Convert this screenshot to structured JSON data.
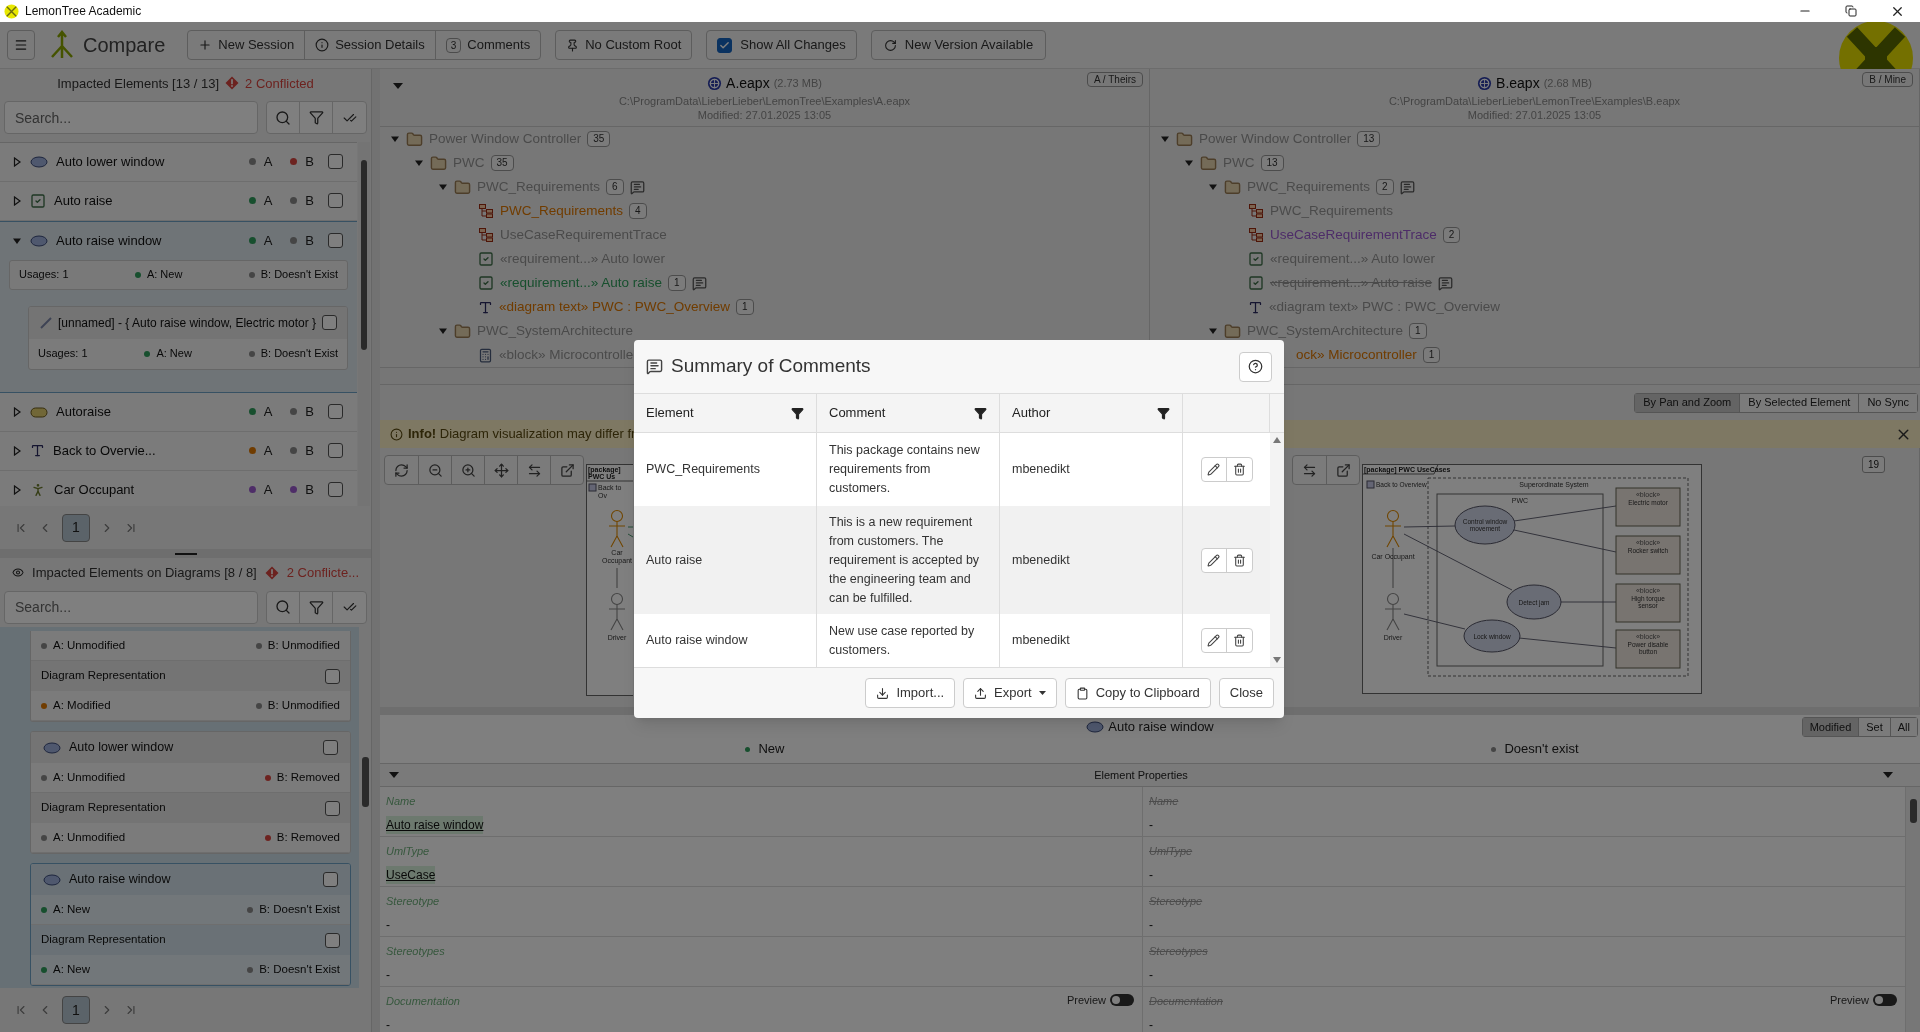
{
  "window": {
    "title": "LemonTree Academic"
  },
  "toolbar": {
    "title": "Compare",
    "group": [
      {
        "kind": "plus",
        "label": "New Session"
      },
      {
        "kind": "info",
        "label": "Session Details"
      },
      {
        "kind": "count",
        "count": "3",
        "label": "Comments"
      }
    ],
    "custom_root": "No Custom Root",
    "show_all": {
      "label": "Show All Changes",
      "checked": true
    },
    "new_version": "New Version Available"
  },
  "impacted": {
    "title": "Impacted Elements [13 / 13]",
    "conflicts": "2 Conflicted",
    "placeholder": "Search...",
    "page": "1",
    "items": [
      {
        "name": "Auto lower window",
        "kind": "usecase",
        "expanded": false,
        "selected": false,
        "checked": false,
        "a": {
          "label": "A",
          "color": "#454545"
        },
        "b": {
          "label": "B",
          "color": "#6d2320"
        }
      },
      {
        "name": "Auto raise",
        "kind": "requirement",
        "expanded": false,
        "selected": false,
        "checked": false,
        "a": {
          "label": "A",
          "color": "#174f2e"
        },
        "b": {
          "label": "B",
          "color": "#454545"
        }
      },
      {
        "name": "Auto raise window",
        "kind": "usecase",
        "expanded": true,
        "selected": true,
        "checked": false,
        "a": {
          "label": "A",
          "color": "#174f2e"
        },
        "b": {
          "label": "B",
          "color": "#454545"
        },
        "usage": {
          "text": "Usages: 1",
          "a": {
            "label": "A: New",
            "color": "#174f2e"
          },
          "b": {
            "label": "B: Doesn't Exist",
            "color": "#454545"
          }
        },
        "children": [
          {
            "name": "[unnamed] - { Auto raise window, Electric motor }",
            "kind": "connector",
            "checked": false,
            "usage": {
              "text": "Usages: 1",
              "a": {
                "label": "A: New",
                "color": "#174f2e"
              },
              "b": {
                "label": "B: Doesn't Exist",
                "color": "#454545"
              }
            }
          }
        ]
      },
      {
        "name": "Autoraise",
        "kind": "state",
        "expanded": false,
        "selected": false,
        "checked": false,
        "a": {
          "label": "A",
          "color": "#174f2e"
        },
        "b": {
          "label": "B",
          "color": "#454545"
        }
      },
      {
        "name": "Back to Overvie...",
        "kind": "text",
        "expanded": false,
        "selected": false,
        "checked": false,
        "a": {
          "label": "A",
          "color": "#703c00"
        },
        "b": {
          "label": "B",
          "color": "#454545"
        }
      },
      {
        "name": "Car Occupant",
        "kind": "actor",
        "expanded": false,
        "selected": false,
        "checked": false,
        "a": {
          "label": "A",
          "color": "#4e2d68"
        },
        "b": {
          "label": "B",
          "color": "#4e2d68"
        }
      }
    ]
  },
  "diagram_impacts": {
    "title": "Impacted Elements on Diagrams [8 / 8]",
    "conflicts": "2 Conflicte...",
    "placeholder": "Search...",
    "page": "1",
    "cards": [
      {
        "selected": false,
        "rows": [
          {
            "kind": "status",
            "a": {
              "label": "A: Unmodified",
              "color": "#454545"
            },
            "b": {
              "label": "B: Unmodified",
              "color": "#454545"
            }
          },
          {
            "kind": "representation",
            "label": "Diagram Representation",
            "checked": false
          },
          {
            "kind": "status",
            "a": {
              "label": "A: Modified",
              "color": "#703c00"
            },
            "b": {
              "label": "B: Unmodified",
              "color": "#454545"
            }
          }
        ]
      },
      {
        "title": "Auto lower window",
        "kind": "usecase",
        "checked": false,
        "selected": false,
        "rows": [
          {
            "kind": "status",
            "a": {
              "label": "A: Unmodified",
              "color": "#454545"
            },
            "b": {
              "label": "B: Removed",
              "color": "#6d2320"
            }
          },
          {
            "kind": "representation",
            "label": "Diagram Representation",
            "checked": false
          },
          {
            "kind": "status",
            "a": {
              "label": "A: Unmodified",
              "color": "#454545"
            },
            "b": {
              "label": "B: Removed",
              "color": "#6d2320"
            }
          }
        ]
      },
      {
        "title": "Auto raise window",
        "kind": "usecase",
        "checked": false,
        "selected": true,
        "rows": [
          {
            "kind": "status",
            "a": {
              "label": "A: New",
              "color": "#174f2e"
            },
            "b": {
              "label": "B: Doesn't Exist",
              "color": "#454545"
            }
          },
          {
            "kind": "representation",
            "label": "Diagram Representation",
            "checked": false
          },
          {
            "kind": "status",
            "a": {
              "label": "A: New",
              "color": "#174f2e"
            },
            "b": {
              "label": "B: Doesn't Exist",
              "color": "#454545"
            }
          }
        ]
      }
    ]
  },
  "sides": [
    {
      "file": "A.eapx",
      "size": "(2.73 MB)",
      "path": "C:\\ProgramData\\LieberLieber\\LemonTree\\Examples\\A.eapx",
      "modified": "Modified: 27.01.2025 13:05",
      "tag": "A / Theirs",
      "tree": [
        {
          "label": "Power Window Controller",
          "kind": "folder",
          "modified": false,
          "added": false,
          "moved": false,
          "deleted": false,
          "comment": false,
          "count": "35",
          "expanded": true,
          "children": [
            {
              "label": "PWC",
              "kind": "folder",
              "modified": false,
              "added": false,
              "moved": false,
              "deleted": false,
              "comment": false,
              "count": "35",
              "expanded": true,
              "children": [
                {
                  "label": "PWC_Requirements",
                  "kind": "folder",
                  "modified": false,
                  "added": false,
                  "moved": false,
                  "deleted": false,
                  "comment": true,
                  "count": "6",
                  "expanded": true,
                  "children": [
                    {
                      "label": "PWC_Requirements",
                      "kind": "diagram",
                      "modified": true,
                      "added": false,
                      "moved": false,
                      "deleted": false,
                      "comment": false,
                      "count": "4"
                    },
                    {
                      "label": "UseCaseRequirementTrace",
                      "kind": "diagram",
                      "modified": false,
                      "added": false,
                      "moved": false,
                      "deleted": false,
                      "comment": false
                    },
                    {
                      "label": "«requirement...» Auto lower",
                      "kind": "requirement",
                      "modified": false,
                      "added": false,
                      "moved": false,
                      "deleted": false,
                      "comment": false
                    },
                    {
                      "label": "«requirement...» Auto raise",
                      "kind": "requirement",
                      "modified": false,
                      "added": true,
                      "moved": false,
                      "deleted": false,
                      "comment": true,
                      "count": "1"
                    },
                    {
                      "label": "«diagram text» PWC : PWC_Overview",
                      "kind": "text",
                      "modified": true,
                      "added": false,
                      "moved": false,
                      "deleted": false,
                      "comment": false,
                      "count": "1"
                    }
                  ]
                },
                {
                  "label": "PWC_SystemArchitecture",
                  "kind": "folder",
                  "modified": false,
                  "added": false,
                  "moved": false,
                  "deleted": false,
                  "comment": false,
                  "expanded": true,
                  "children": [
                    {
                      "label": "«block» Microcontrolle",
                      "kind": "block",
                      "modified": false,
                      "added": false,
                      "moved": false,
                      "deleted": false,
                      "comment": false
                    }
                  ]
                }
              ]
            }
          ]
        }
      ]
    },
    {
      "file": "B.eapx",
      "size": "(2.68 MB)",
      "path": "C:\\ProgramData\\LieberLieber\\LemonTree\\Examples\\B.eapx",
      "modified": "Modified: 27.01.2025 13:05",
      "tag": "B / Mine",
      "tree": [
        {
          "label": "Power Window Controller",
          "kind": "folder",
          "modified": false,
          "added": false,
          "moved": false,
          "deleted": false,
          "comment": false,
          "count": "13",
          "expanded": true,
          "children": [
            {
              "label": "PWC",
              "kind": "folder",
              "modified": false,
              "added": false,
              "moved": false,
              "deleted": false,
              "comment": false,
              "count": "13",
              "expanded": true,
              "children": [
                {
                  "label": "PWC_Requirements",
                  "kind": "folder",
                  "modified": false,
                  "added": false,
                  "moved": false,
                  "deleted": false,
                  "comment": true,
                  "count": "2",
                  "expanded": true,
                  "children": [
                    {
                      "label": "PWC_Requirements",
                      "kind": "diagram",
                      "modified": false,
                      "added": false,
                      "moved": false,
                      "deleted": false,
                      "comment": false
                    },
                    {
                      "label": "UseCaseRequirementTrace",
                      "kind": "diagram",
                      "modified": false,
                      "added": false,
                      "moved": true,
                      "deleted": false,
                      "comment": false,
                      "count": "2"
                    },
                    {
                      "label": "«requirement...» Auto lower",
                      "kind": "requirement",
                      "modified": false,
                      "added": false,
                      "moved": false,
                      "deleted": false,
                      "comment": false
                    },
                    {
                      "label": "«requirement...» Auto raise",
                      "kind": "requirement",
                      "modified": false,
                      "added": false,
                      "moved": false,
                      "deleted": true,
                      "comment": true
                    },
                    {
                      "label": "«diagram text» PWC : PWC_Overview",
                      "kind": "text",
                      "modified": false,
                      "added": false,
                      "moved": false,
                      "deleted": false,
                      "comment": false
                    }
                  ]
                },
                {
                  "label": "PWC_SystemArchitecture",
                  "kind": "folder",
                  "modified": false,
                  "added": false,
                  "moved": false,
                  "deleted": false,
                  "comment": false,
                  "count": "1",
                  "expanded": true,
                  "children": [
                    {
                      "label": "ock» Microcontroller",
                      "modified": true,
                      "added": false,
                      "moved": false,
                      "deleted": false,
                      "comment": false,
                      "count": "1"
                    }
                  ]
                }
              ]
            }
          ]
        }
      ]
    }
  ],
  "sync": [
    {
      "label": "By Pan and Zoom",
      "selected": true
    },
    {
      "label": "By Selected Element",
      "selected": false
    },
    {
      "label": "No Sync",
      "selected": false
    }
  ],
  "info": "**Info!** Diagram visualization may differ fr",
  "diagrams": [
    {
      "title": "[package] PWC  Us",
      "link": "Back to Ov",
      "actors": [
        "Car Occupant",
        "Driver"
      ]
    },
    {
      "title": "[package] PWC  UseCases",
      "link": "Back to Overview",
      "boundary": "Superordinate System",
      "subject": "PWC",
      "use_cases": [
        "Control window movement",
        "Detect jam",
        "Lock window"
      ],
      "blocks": [
        {
          "stereotype": "«block»",
          "name": "Electric motor"
        },
        {
          "stereotype": "«block»",
          "name": "Rocker switch"
        },
        {
          "stereotype": "«block»",
          "name": "High torque sensor"
        },
        {
          "stereotype": "«block»",
          "name": "Power disable button"
        }
      ],
      "actors": [
        "Car Occupant",
        "Driver"
      ],
      "badge": "19"
    }
  ],
  "properties": {
    "element": "Auto raise window",
    "filters": [
      {
        "label": "Modified",
        "selected": true
      },
      {
        "label": "Set",
        "selected": false
      },
      {
        "label": "All",
        "selected": false
      }
    ],
    "a_state": {
      "label": "New",
      "color": "#174f2e"
    },
    "b_state": {
      "label": "Doesn't exist",
      "color": "#454545"
    },
    "b_exists": false,
    "section": "Element Properties",
    "rows": [
      {
        "changed": true,
        "a": {
          "name": "Name",
          "value": "Auto raise window"
        },
        "b": {
          "name": "Name",
          "value": "-"
        }
      },
      {
        "changed": true,
        "a": {
          "name": "UmlType",
          "value": "UseCase"
        },
        "b": {
          "name": "UmlType",
          "value": "-"
        }
      },
      {
        "changed": false,
        "a": {
          "name": "Stereotype",
          "value": "-"
        },
        "b": {
          "name": "Stereotype",
          "value": "-"
        }
      },
      {
        "changed": false,
        "a": {
          "name": "Stereotypes",
          "value": "-"
        },
        "b": {
          "name": "Stereotypes",
          "value": "-"
        }
      },
      {
        "changed": false,
        "a": {
          "name": "Documentation",
          "value": "-",
          "preview": {
            "label": "Preview",
            "on": false
          }
        },
        "b": {
          "name": "Documentation",
          "value": "-",
          "preview": {
            "label": "Preview",
            "on": false
          }
        }
      }
    ]
  },
  "dialog": {
    "title": "Summary of Comments",
    "columns": [
      "Element",
      "Comment",
      "Author"
    ],
    "rows": [
      {
        "element": "PWC_Requirements",
        "comment": "This package contains new requirements from customers.",
        "author": "mbenedikt"
      },
      {
        "element": "Auto raise",
        "comment": "This is a new requirement from customers. The requirement is accepted by the engineering team and can be fulfilled.",
        "author": "mbenedikt"
      },
      {
        "element": "Auto raise window",
        "comment": "New use case reported by customers.",
        "author": "mbenedikt"
      }
    ],
    "buttons": [
      {
        "kind": "import",
        "label": "Import..."
      },
      {
        "kind": "export",
        "label": "Export"
      },
      {
        "kind": "copy",
        "label": "Copy to Clipboard"
      },
      {
        "kind": "close",
        "label": "Close"
      }
    ]
  }
}
